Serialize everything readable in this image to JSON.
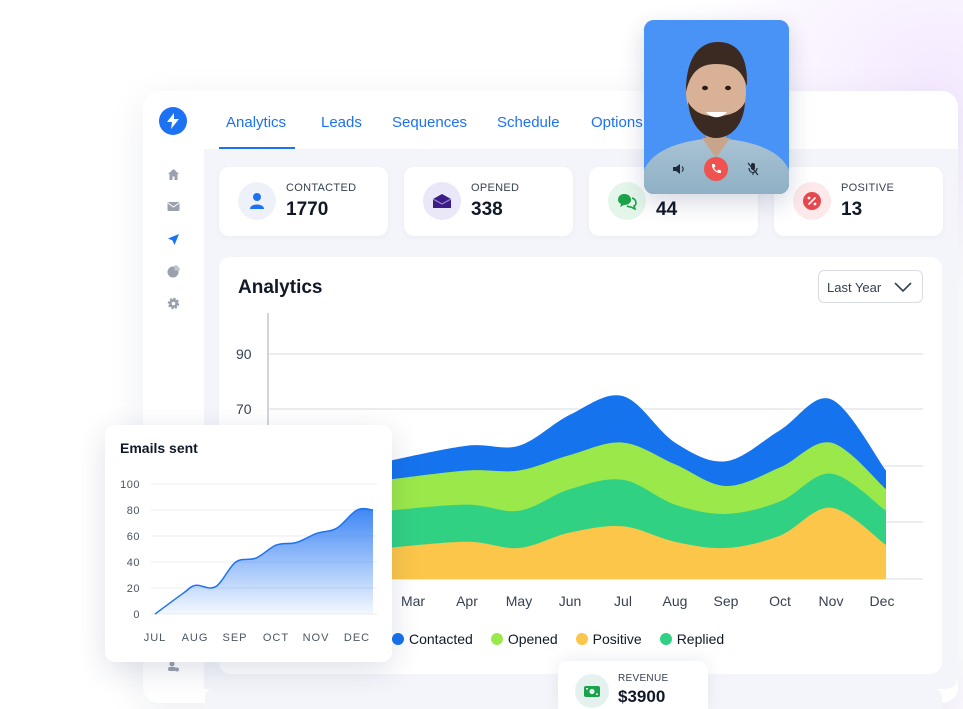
{
  "nav": {
    "tabs": [
      {
        "label": "Analytics",
        "active": true
      },
      {
        "label": "Leads"
      },
      {
        "label": "Sequences"
      },
      {
        "label": "Schedule"
      },
      {
        "label": "Options"
      }
    ]
  },
  "sidebar": {
    "icons": [
      "home-icon",
      "mail-icon",
      "send-icon",
      "pie-chart-icon",
      "gear-icon"
    ]
  },
  "stats": [
    {
      "label": "CONTACTED",
      "value": "1770",
      "icon": "user-icon",
      "bg": "#eef2f8",
      "fg": "#1d72f3"
    },
    {
      "label": "OPENED",
      "value": "338",
      "icon": "envelope-icon",
      "bg": "#e9e7f8",
      "fg": "#3c1d86"
    },
    {
      "label": "",
      "value": "44",
      "icon": "chat-icon",
      "bg": "#e4f6ea",
      "fg": "#1aa34a"
    },
    {
      "label": "POSITIVE",
      "value": "13",
      "icon": "percent-icon",
      "bg": "#fde9ea",
      "fg": "#e5484d"
    }
  ],
  "analytics": {
    "title": "Analytics",
    "period": "Last Year",
    "legend": [
      {
        "label": "Contacted",
        "color": "#1673ee"
      },
      {
        "label": "Opened",
        "color": "#9be84a"
      },
      {
        "label": "Positive",
        "color": "#fbc649"
      },
      {
        "label": "Replied",
        "color": "#31d184"
      }
    ],
    "y_ticks": [
      "90",
      "70"
    ],
    "x_labels": [
      "Mar",
      "Apr",
      "May",
      "Jun",
      "Jul",
      "Aug",
      "Sep",
      "Oct",
      "Nov",
      "Dec"
    ]
  },
  "emails_sent": {
    "title": "Emails sent"
  },
  "revenue": {
    "label": "REVENUE",
    "value": "$3900"
  },
  "colors": {
    "accent": "#1d72f3"
  },
  "chart_data": [
    {
      "type": "area",
      "stacked": true,
      "title": "Analytics",
      "categories": [
        "Mar",
        "Apr",
        "May",
        "Jun",
        "Jul",
        "Aug",
        "Sep",
        "Oct",
        "Nov",
        "Dec"
      ],
      "series": [
        {
          "name": "Positive",
          "values": [
            10,
            12,
            10,
            15,
            17,
            12,
            10,
            14,
            23,
            11
          ]
        },
        {
          "name": "Replied",
          "values": [
            12,
            12,
            12,
            14,
            15,
            12,
            11,
            11,
            11,
            11
          ]
        },
        {
          "name": "Opened",
          "values": [
            10,
            11,
            13,
            11,
            12,
            13,
            9,
            11,
            10,
            7
          ]
        },
        {
          "name": "Contacted",
          "values": [
            6,
            8,
            8,
            13,
            15,
            7,
            8,
            12,
            14,
            6
          ]
        }
      ],
      "ylim": [
        0,
        100
      ],
      "y_ticks": [
        70,
        90
      ],
      "grid": true,
      "legend": "bottom"
    },
    {
      "type": "area",
      "title": "Emails sent",
      "categories": [
        "JUL",
        "AUG",
        "SEP",
        "OCT",
        "NOV",
        "DEC"
      ],
      "x": [
        0,
        0.7,
        1,
        1.5,
        2,
        2.5,
        3,
        3.5,
        4,
        4.5,
        5,
        5.5
      ],
      "values": [
        0,
        16,
        22,
        21,
        40,
        43,
        53,
        55,
        62,
        66,
        80,
        80
      ],
      "ylim": [
        0,
        100
      ],
      "y_ticks": [
        0,
        20,
        40,
        60,
        80,
        100
      ],
      "grid": true
    }
  ]
}
